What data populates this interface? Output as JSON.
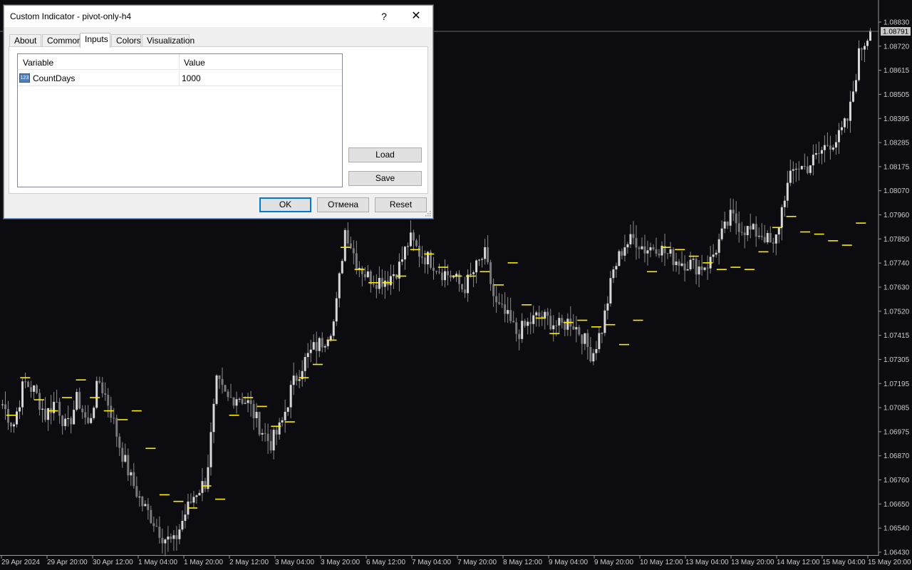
{
  "window": {
    "title": "Custom Indicator - pivot-only-h4",
    "help_label": "?",
    "close_label": "✕"
  },
  "tabs": [
    {
      "label": "About",
      "active": false
    },
    {
      "label": "Common",
      "active": false
    },
    {
      "label": "Inputs",
      "active": true
    },
    {
      "label": "Colors",
      "active": false
    },
    {
      "label": "Visualization",
      "active": false
    }
  ],
  "inputs_table": {
    "columns": [
      "Variable",
      "Value"
    ],
    "rows": [
      {
        "icon": "numeric-123-icon",
        "icon_text": "123",
        "variable": "CountDays",
        "value": "1000"
      }
    ]
  },
  "side_buttons": {
    "load": "Load",
    "save": "Save"
  },
  "footer_buttons": {
    "ok": "OK",
    "cancel": "Отмена",
    "reset": "Reset"
  },
  "chart_data": {
    "type": "candlestick",
    "price_axis_ticks": [
      "1.08830",
      "1.08720",
      "1.08615",
      "1.08505",
      "1.08395",
      "1.08285",
      "1.08175",
      "1.08070",
      "1.07960",
      "1.07850",
      "1.07740",
      "1.07630",
      "1.07520",
      "1.07415",
      "1.07305",
      "1.07195",
      "1.07085",
      "1.06975",
      "1.06870",
      "1.06760",
      "1.06650",
      "1.06540",
      "1.06430"
    ],
    "price_ylim": [
      1.0643,
      1.0883
    ],
    "current_price": "1.08791",
    "time_axis_labels": [
      "29 Apr 2024",
      "29 Apr 20:00",
      "30 Apr 12:00",
      "1 May 04:00",
      "1 May 20:00",
      "2 May 12:00",
      "3 May 04:00",
      "3 May 20:00",
      "6 May 12:00",
      "7 May 04:00",
      "7 May 20:00",
      "8 May 12:00",
      "9 May 04:00",
      "9 May 20:00",
      "10 May 12:00",
      "13 May 04:00",
      "13 May 20:00",
      "14 May 12:00",
      "15 May 04:00",
      "15 May 20:00"
    ],
    "price_path": [
      1.071,
      1.07,
      1.072,
      1.0716,
      1.0705,
      1.0712,
      1.0698,
      1.0713,
      1.07,
      1.0721,
      1.0709,
      1.069,
      1.0676,
      1.0665,
      1.0658,
      1.065,
      1.0647,
      1.066,
      1.067,
      1.0675,
      1.072,
      1.0712,
      1.0714,
      1.071,
      1.07,
      1.0692,
      1.07,
      1.0718,
      1.0728,
      1.0735,
      1.0739,
      1.0748,
      1.079,
      1.0775,
      1.0768,
      1.0766,
      1.0767,
      1.0772,
      1.0785,
      1.0778,
      1.0775,
      1.077,
      1.0768,
      1.0762,
      1.077,
      1.0778,
      1.0755,
      1.075,
      1.0742,
      1.0746,
      1.075,
      1.0748,
      1.0745,
      1.0748,
      1.0742,
      1.0732,
      1.0745,
      1.077,
      1.0782,
      1.0785,
      1.078,
      1.0782,
      1.0778,
      1.0775,
      1.0774,
      1.0772,
      1.0774,
      1.0785,
      1.0795,
      1.079,
      1.0788,
      1.0787,
      1.078,
      1.0805,
      1.0818,
      1.0817,
      1.0822,
      1.0828,
      1.083,
      1.084,
      1.087,
      1.0879
    ],
    "pivot_levels": [
      1.0705,
      1.0722,
      1.0712,
      1.0707,
      1.0713,
      1.0721,
      1.0713,
      1.0707,
      1.0703,
      1.0707,
      1.069,
      1.0669,
      1.0666,
      1.0663,
      1.0673,
      1.0667,
      1.0705,
      1.0713,
      1.0709,
      1.07,
      1.0702,
      1.0722,
      1.0728,
      1.0739,
      1.0781,
      1.0771,
      1.0765,
      1.0765,
      1.0768,
      1.078,
      1.0778,
      1.0772,
      1.0768,
      1.0768,
      1.077,
      1.0764,
      1.0774,
      1.0755,
      1.0749,
      1.0742,
      1.0747,
      1.0748,
      1.0745,
      1.0746,
      1.0737,
      1.0748,
      1.077,
      1.0781,
      1.078,
      1.0777,
      1.0774,
      1.0771,
      1.0772,
      1.0771,
      1.0779,
      1.079,
      1.0795,
      1.0788,
      1.0787,
      1.0784,
      1.0782,
      1.0792
    ]
  }
}
